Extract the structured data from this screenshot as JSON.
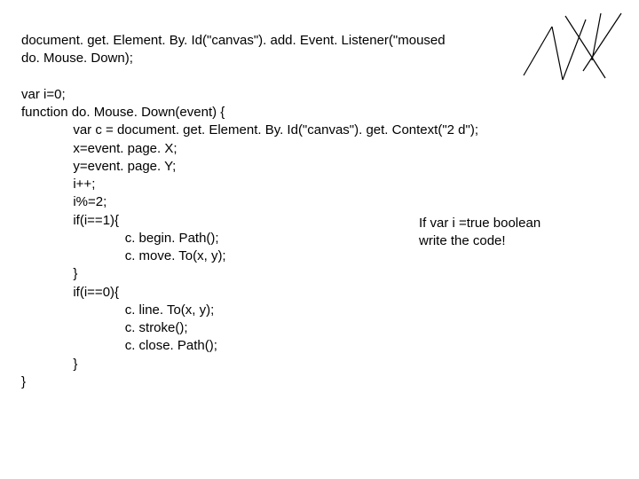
{
  "code": "document. get. Element. By. Id(\"canvas\"). add. Event. Listener(\"moused\ndo. Mouse. Down);\n\nvar i=0;\nfunction do. Mouse. Down(event) {\n              var c = document. get. Element. By. Id(\"canvas\"). get. Context(\"2 d\");\n              x=event. page. X;\n              y=event. page. Y;\n              i++;\n              i%=2;\n              if(i==1){\n                            c. begin. Path();\n                            c. move. To(x, y);\n              }\n              if(i==0){\n                            c. line. To(x, y);\n                            c. stroke();\n                            c. close. Path();\n              }\n}",
  "annotation": "If var i =true boolean\nwrite the code!"
}
